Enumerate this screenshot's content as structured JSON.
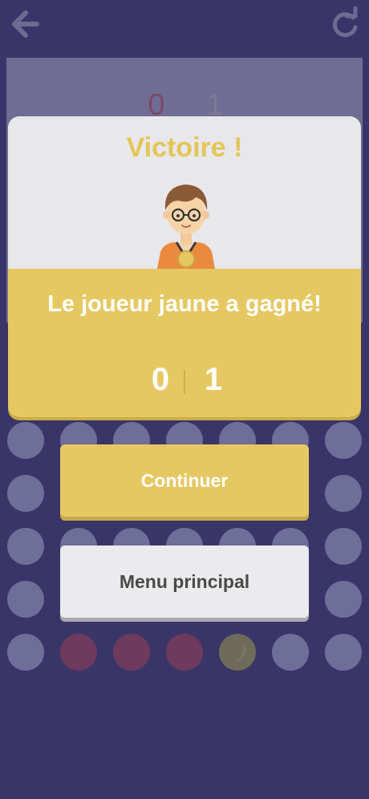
{
  "header": {
    "back_icon": "arrow-left-icon",
    "restart_icon": "restart-icon"
  },
  "background": {
    "score_left": "0",
    "score_right": "1"
  },
  "dialog": {
    "title": "Victoire !",
    "avatar_icon": "player-avatar-with-medal",
    "message": "Le joueur jaune a gagné!",
    "score_left": "0",
    "score_right": "1"
  },
  "buttons": {
    "continue": "Continuer",
    "menu": "Menu principal"
  },
  "colors": {
    "background": "#3a3568",
    "accent_yellow": "#e6c862",
    "title_yellow": "#e3c558",
    "dialog_light": "#e8e8ea"
  }
}
